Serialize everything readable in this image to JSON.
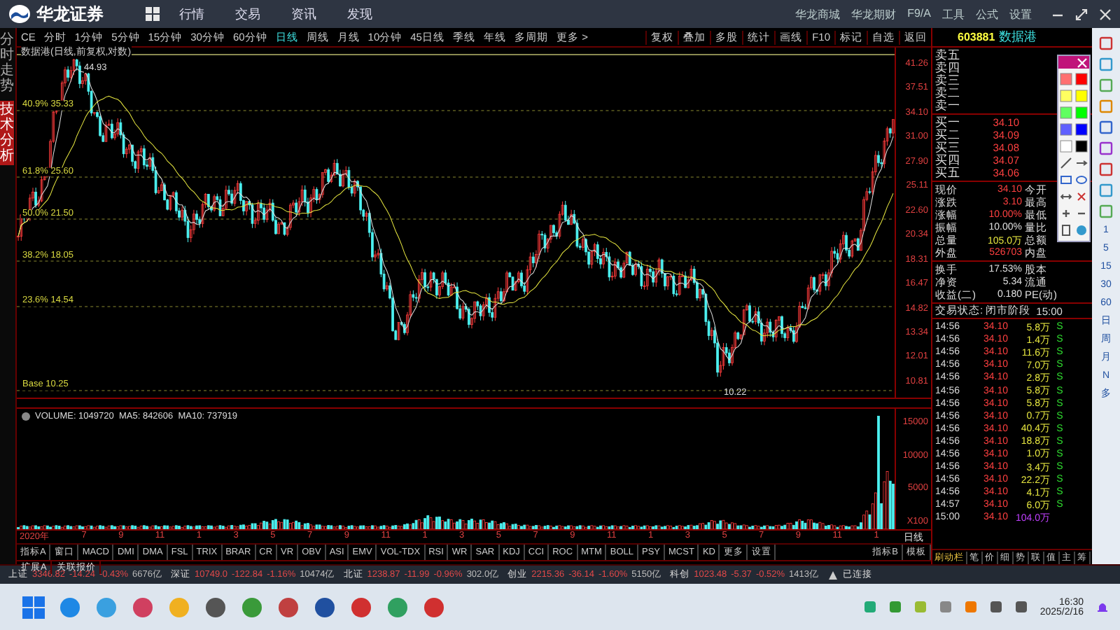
{
  "app_bar": {
    "logo": "华龙证券",
    "menu": [
      "行情",
      "交易",
      "资讯",
      "发现"
    ],
    "links": [
      "华龙商城",
      "华龙期财",
      "F9/A",
      "工具",
      "公式",
      "设置"
    ]
  },
  "left_tabs": [
    {
      "label": "分时走势",
      "selected": false
    },
    {
      "label": "技术分析",
      "selected": true
    }
  ],
  "period_tabs": [
    {
      "label": "CE",
      "selected": false
    },
    {
      "label": "分时",
      "selected": false
    },
    {
      "label": "1分钟",
      "selected": false
    },
    {
      "label": "5分钟",
      "selected": false
    },
    {
      "label": "15分钟",
      "selected": false
    },
    {
      "label": "30分钟",
      "selected": false
    },
    {
      "label": "60分钟",
      "selected": false
    },
    {
      "label": "日线",
      "selected": true
    },
    {
      "label": "周线",
      "selected": false
    },
    {
      "label": "月线",
      "selected": false
    },
    {
      "label": "10分钟",
      "selected": false
    },
    {
      "label": "45日线",
      "selected": false
    },
    {
      "label": "季线",
      "selected": false
    },
    {
      "label": "年线",
      "selected": false
    },
    {
      "label": "多周期",
      "selected": false
    },
    {
      "label": "更多 >",
      "selected": false
    }
  ],
  "tool_buttons": [
    "复权",
    "叠加",
    "多股",
    "统计",
    "画线",
    "F10",
    "标记",
    "自选",
    "返回"
  ],
  "chart": {
    "title": "数据港(日线,前复权,对数)",
    "high_label": "44.93",
    "low_label": "10.22",
    "fib_labels": [
      "40.9% 35.33",
      "61.8% 25.60",
      "50.0% 21.50",
      "38.2% 18.05",
      "23.6% 14.54",
      "Base 10.25"
    ],
    "price_axis": [
      "41.26",
      "37.51",
      "34.10",
      "31.00",
      "27.90",
      "25.11",
      "22.60",
      "20.34",
      "18.31",
      "16.47",
      "14.82",
      "13.34",
      "12.01",
      "10.81"
    ]
  },
  "volume": {
    "legend": "VOLUME: 1049720  MA5: 842606  MA10: 737919",
    "axis": [
      "15000",
      "10000",
      "5000",
      "X100"
    ]
  },
  "date_axis": {
    "labels": [
      "2020年",
      "7",
      "9",
      "11",
      "1",
      "3",
      "5",
      "7",
      "9",
      "11",
      "1",
      "3",
      "5",
      "7",
      "9",
      "11",
      "1",
      "3",
      "5",
      "7",
      "9",
      "11",
      "1"
    ],
    "period": "日线"
  },
  "indicator_tabs": [
    "指标A",
    "窗口",
    "MACD",
    "DMI",
    "DMA",
    "FSL",
    "TRIX",
    "BRAR",
    "CR",
    "VR",
    "OBV",
    "ASI",
    "EMV",
    "VOL-TDX",
    "RSI",
    "WR",
    "SAR",
    "KDJ",
    "CCI",
    "ROC",
    "MTM",
    "BOLL",
    "PSY",
    "MCST",
    "KD",
    "更多",
    "设置"
  ],
  "indicator_right": [
    "指标B",
    "模板"
  ],
  "extension_tabs": [
    "扩展A",
    "关联报价"
  ],
  "stock": {
    "code": "603881",
    "name": "数据港"
  },
  "order_book": {
    "asks": [
      "卖五",
      "卖四",
      "卖三",
      "卖二",
      "卖一"
    ],
    "bids": [
      {
        "label": "买一",
        "price": "34.10"
      },
      {
        "label": "买二",
        "price": "34.09"
      },
      {
        "label": "买三",
        "price": "34.08"
      },
      {
        "label": "买四",
        "price": "34.07"
      },
      {
        "label": "买五",
        "price": "34.06"
      }
    ]
  },
  "stats": [
    {
      "label": "现价",
      "value": "34.10",
      "color": "#ff4040",
      "label2": "今开"
    },
    {
      "label": "涨跌",
      "value": "3.10",
      "color": "#ff4040",
      "label2": "最高"
    },
    {
      "label": "涨幅",
      "value": "10.00%",
      "color": "#ff4040",
      "label2": "最低"
    },
    {
      "label": "振幅",
      "value": "10.00%",
      "color": "#e0e0e0",
      "label2": "量比"
    },
    {
      "label": "总量",
      "value": "105.0万",
      "color": "#e8e840",
      "label2": "总额"
    },
    {
      "label": "外盘",
      "value": "526703",
      "color": "#ff4040",
      "label2": "内盘"
    },
    {
      "label": "换手",
      "value": "17.53%",
      "color": "#e0e0e0",
      "label2": "股本"
    },
    {
      "label": "净资",
      "value": "5.34",
      "color": "#e0e0e0",
      "label2": "流通"
    },
    {
      "label": "收益(二)",
      "value": "0.180",
      "color": "#e0e0e0",
      "label2": "PE(动)"
    }
  ],
  "trade_status": {
    "label": "交易状态: 闭市阶段",
    "time": "15:00"
  },
  "trades": [
    {
      "time": "14:56",
      "price": "34.10",
      "volume": "5.8万",
      "color": "#e8e840",
      "side": "S"
    },
    {
      "time": "14:56",
      "price": "34.10",
      "volume": "1.4万",
      "color": "#e8e840",
      "side": "S"
    },
    {
      "time": "14:56",
      "price": "34.10",
      "volume": "11.6万",
      "color": "#e8e840",
      "side": "S"
    },
    {
      "time": "14:56",
      "price": "34.10",
      "volume": "7.0万",
      "color": "#e8e840",
      "side": "S"
    },
    {
      "time": "14:56",
      "price": "34.10",
      "volume": "2.8万",
      "color": "#e8e840",
      "side": "S"
    },
    {
      "time": "14:56",
      "price": "34.10",
      "volume": "5.8万",
      "color": "#e8e840",
      "side": "S"
    },
    {
      "time": "14:56",
      "price": "34.10",
      "volume": "5.8万",
      "color": "#e8e840",
      "side": "S"
    },
    {
      "time": "14:56",
      "price": "34.10",
      "volume": "0.7万",
      "color": "#e8e840",
      "side": "S"
    },
    {
      "time": "14:56",
      "price": "34.10",
      "volume": "40.4万",
      "color": "#e8e840",
      "side": "S"
    },
    {
      "time": "14:56",
      "price": "34.10",
      "volume": "18.8万",
      "color": "#e8e840",
      "side": "S"
    },
    {
      "time": "14:56",
      "price": "34.10",
      "volume": "1.0万",
      "color": "#e8e840",
      "side": "S"
    },
    {
      "time": "14:56",
      "price": "34.10",
      "volume": "3.4万",
      "color": "#e8e840",
      "side": "S"
    },
    {
      "time": "14:56",
      "price": "34.10",
      "volume": "22.2万",
      "color": "#e8e840",
      "side": "S"
    },
    {
      "time": "14:56",
      "price": "34.10",
      "volume": "4.1万",
      "color": "#e8e840",
      "side": "S"
    },
    {
      "time": "14:57",
      "price": "34.10",
      "volume": "6.0万",
      "color": "#e8e840",
      "side": "S"
    },
    {
      "time": "15:00",
      "price": "34.10",
      "volume": "104.0万",
      "color": "#c040ff"
    }
  ],
  "panel_tabs": [
    "刷动栏",
    "笔",
    "价",
    "细",
    "势",
    "联",
    "值",
    "主",
    "筹"
  ],
  "right_strip": [
    "1",
    "5",
    "15",
    "30",
    "60",
    "日",
    "周",
    "月",
    "N",
    "多"
  ],
  "status_bar": {
    "indices": [
      {
        "name": "上证",
        "price": "3346.82",
        "change": "-14.24",
        "percent": "-0.43%",
        "amount": "6676亿"
      },
      {
        "name": "深证",
        "price": "10749.0",
        "change": "-122.84",
        "percent": "-1.16%",
        "amount": "10474亿"
      },
      {
        "name": "北证",
        "price": "1238.87",
        "change": "-11.99",
        "percent": "-0.96%",
        "amount": "302.0亿"
      },
      {
        "name": "创业",
        "price": "2215.36",
        "change": "-36.14",
        "percent": "-1.60%",
        "amount": "5150亿"
      },
      {
        "name": "科创",
        "price": "1023.48",
        "change": "-5.37",
        "percent": "-0.52%",
        "amount": "1413亿"
      }
    ],
    "connection": "已连接"
  },
  "taskbar": {
    "time": "16:30",
    "date": "2025/2/16"
  }
}
